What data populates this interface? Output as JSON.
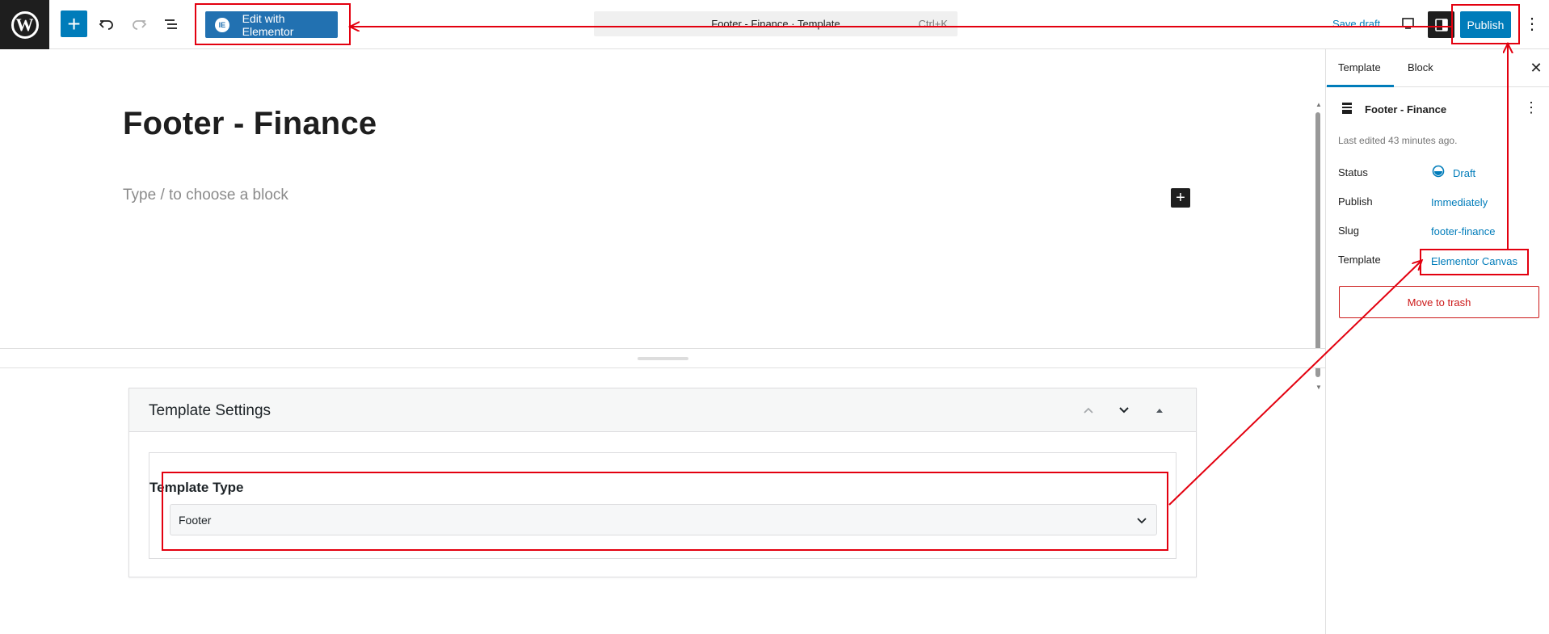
{
  "toolbar": {
    "edit_with_elementor": "Edit with Elementor",
    "elementor_icon_glyph": "IE",
    "document_title": "Footer - Finance · Template",
    "shortcut": "Ctrl+K",
    "save_draft": "Save draft",
    "publish": "Publish",
    "more": "⋮",
    "add": "+"
  },
  "editor": {
    "title": "Footer - Finance",
    "block_placeholder": "Type / to choose a block",
    "block_add": "+"
  },
  "metabox": {
    "title": "Template Settings",
    "field_label": "Template Type",
    "selected_value": "Footer"
  },
  "sidebar": {
    "tabs": [
      {
        "label": "Template",
        "active": true
      },
      {
        "label": "Block",
        "active": false
      }
    ],
    "close": "✕",
    "doc_title": "Footer - Finance",
    "doc_more": "⋮",
    "last_edited": "Last edited 43 minutes ago.",
    "rows": [
      {
        "label": "Status",
        "value": "Draft"
      },
      {
        "label": "Publish",
        "value": "Immediately"
      },
      {
        "label": "Slug",
        "value": "footer-finance"
      },
      {
        "label": "Template",
        "value": "Elementor Canvas"
      }
    ],
    "trash": "Move to trash"
  },
  "icons": [
    "wordpress-logo-icon",
    "plus-icon",
    "undo-icon",
    "redo-icon",
    "list-view-icon",
    "elementor-icon",
    "desktop-view-icon",
    "settings-panel-icon",
    "more-vertical-icon",
    "close-icon",
    "template-part-icon",
    "draft-status-icon",
    "chevron-up-icon",
    "chevron-down-icon",
    "triangle-up-icon"
  ],
  "colors": {
    "accent": "#007cba",
    "elementor_button": "#2271b1",
    "danger": "#cc1818",
    "annotation": "#e3000f"
  }
}
